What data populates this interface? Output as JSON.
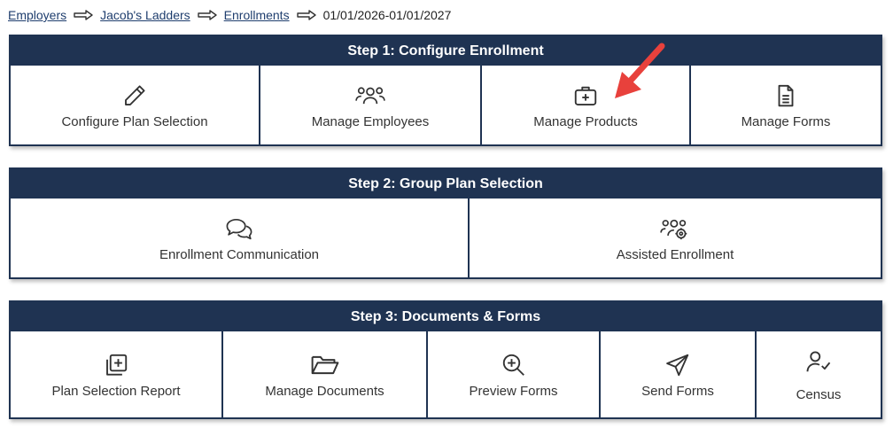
{
  "breadcrumb": {
    "items": [
      "Employers",
      "Jacob's Ladders",
      "Enrollments"
    ],
    "current": "01/01/2026-01/01/2027"
  },
  "steps": [
    {
      "title": "Step 1: Configure Enrollment",
      "tiles": [
        "Configure Plan Selection",
        "Manage Employees",
        "Manage Products",
        "Manage Forms"
      ]
    },
    {
      "title": "Step 2: Group Plan Selection",
      "tiles": [
        "Enrollment Communication",
        "Assisted Enrollment"
      ]
    },
    {
      "title": "Step 3: Documents & Forms",
      "tiles": [
        "Plan Selection Report",
        "Manage Documents",
        "Preview Forms",
        "Send Forms",
        "Census"
      ]
    }
  ],
  "colors": {
    "header_bg": "#1f3352",
    "link": "#1f3e6e",
    "annotation_arrow": "#e8413c"
  },
  "icons": {
    "step1": [
      "pencil-icon",
      "users-icon",
      "medical-kit-icon",
      "document-icon"
    ],
    "step2": [
      "chat-bubbles-icon",
      "users-gear-icon"
    ],
    "step3": [
      "add-copy-icon",
      "folder-icon",
      "zoom-in-icon",
      "paper-plane-icon",
      "user-check-icon"
    ]
  }
}
